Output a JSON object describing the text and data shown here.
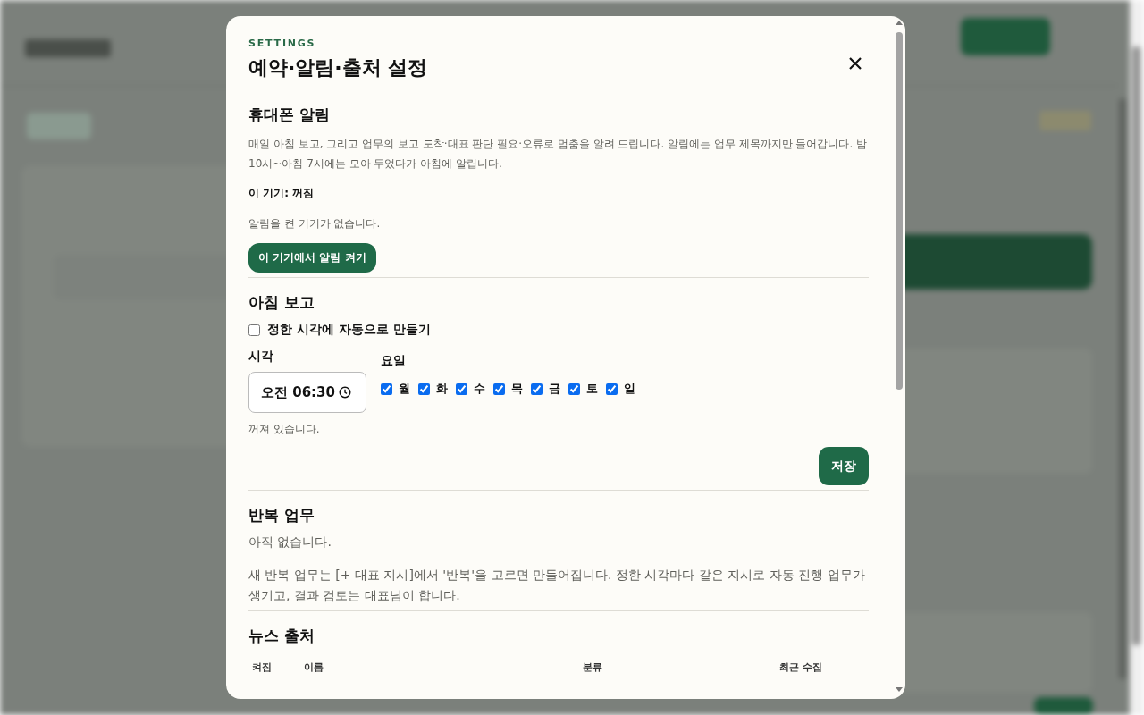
{
  "modal": {
    "eyebrow": "SETTINGS",
    "title": "예약·알림·출처 설정"
  },
  "push": {
    "heading": "휴대폰 알림",
    "description": "매일 아침 보고, 그리고 업무의 보고 도착·대표 판단 필요·오류로 멈춤을 알려 드립니다. 알림에는 업무 제목까지만 들어갑니다. 밤 10시~아침 7시에는 모아 두었다가 아침에 알립니다.",
    "device_status": "이 기기: 꺼짐",
    "no_devices": "알림을 켠 기기가 없습니다.",
    "button": "이 기기에서 알림 켜기"
  },
  "morning": {
    "heading": "아침 보고",
    "auto_create": {
      "label": "정한 시각에 자동으로 만들기",
      "checked": false
    },
    "time_label": "시각",
    "time_value": "오전 06:30",
    "days_label": "요일",
    "days": [
      {
        "label": "월",
        "checked": true
      },
      {
        "label": "화",
        "checked": true
      },
      {
        "label": "수",
        "checked": true
      },
      {
        "label": "목",
        "checked": true
      },
      {
        "label": "금",
        "checked": true
      },
      {
        "label": "토",
        "checked": true
      },
      {
        "label": "일",
        "checked": true
      }
    ],
    "status": "꺼져 있습니다.",
    "save": "저장"
  },
  "recurring": {
    "heading": "반복 업무",
    "empty": "아직 없습니다.",
    "description": "새 반복 업무는 [+ 대표 지시]에서 '반복'을 고르면 만들어집니다. 정한 시각마다 같은 지시로 자동 진행 업무가 생기고, 결과 검토는 대표님이 합니다."
  },
  "news": {
    "heading": "뉴스 출처",
    "columns": [
      "켜짐",
      "이름",
      "분류",
      "최근 수집"
    ]
  }
}
